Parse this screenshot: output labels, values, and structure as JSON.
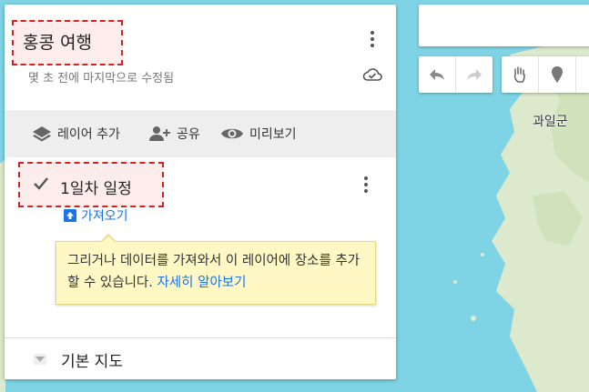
{
  "map_title": "홍콩 여행",
  "saved_status": "몇 초 전에 마지막으로 수정됨",
  "toolbar": {
    "add_layer": "레이어 추가",
    "share": "공유",
    "preview": "미리보기"
  },
  "layer": {
    "name": "1일차 일정",
    "import_label": "가져오기"
  },
  "tooltip": {
    "text": "그리거나 데이터를 가져와서 이 레이어에 장소를 추가할 수 있습니다.",
    "link": "자세히 알아보기"
  },
  "base_map": {
    "label": "기본 지도"
  },
  "map": {
    "place_label": "과일군"
  },
  "colors": {
    "accent": "#1a73e8",
    "highlight_border": "#d32222",
    "tooltip_bg": "#fff8c4",
    "water": "#7ed4e4",
    "land": "#d9e8c8"
  }
}
